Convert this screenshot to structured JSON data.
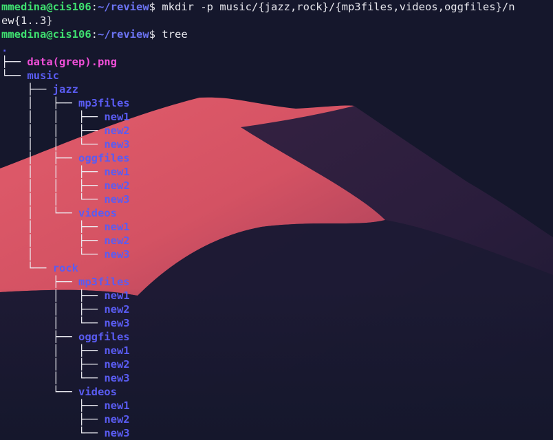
{
  "colors": {
    "background": "#15172c",
    "dune": "#d85868",
    "prompt_user": "#3fe070",
    "prompt_path": "#6c74f4",
    "directory": "#5a5cf2",
    "image_file": "#f04fd8"
  },
  "prompt": {
    "user_host": "mmedina@cis106",
    "cwd": "~/review",
    "symbol": "$"
  },
  "commands": {
    "first_line": "mkdir -p music/{jazz,rock}/{mp3files,videos,oggfiles}/n",
    "first_wrap": "ew{1..3}",
    "second": "tree"
  },
  "tree": {
    "root": ".",
    "entries": [
      {
        "prefix": "├── ",
        "name": "data(grep).png",
        "kind": "img"
      },
      {
        "prefix": "└── ",
        "name": "music",
        "kind": "dir"
      },
      {
        "prefix": "    ├── ",
        "name": "jazz",
        "kind": "dir"
      },
      {
        "prefix": "    │   ├── ",
        "name": "mp3files",
        "kind": "dir"
      },
      {
        "prefix": "    │   │   ├── ",
        "name": "new1",
        "kind": "dir"
      },
      {
        "prefix": "    │   │   ├── ",
        "name": "new2",
        "kind": "dir"
      },
      {
        "prefix": "    │   │   └── ",
        "name": "new3",
        "kind": "dir"
      },
      {
        "prefix": "    │   ├── ",
        "name": "oggfiles",
        "kind": "dir"
      },
      {
        "prefix": "    │   │   ├── ",
        "name": "new1",
        "kind": "dir"
      },
      {
        "prefix": "    │   │   ├── ",
        "name": "new2",
        "kind": "dir"
      },
      {
        "prefix": "    │   │   └── ",
        "name": "new3",
        "kind": "dir"
      },
      {
        "prefix": "    │   └── ",
        "name": "videos",
        "kind": "dir"
      },
      {
        "prefix": "    │       ├── ",
        "name": "new1",
        "kind": "dir"
      },
      {
        "prefix": "    │       ├── ",
        "name": "new2",
        "kind": "dir"
      },
      {
        "prefix": "    │       └── ",
        "name": "new3",
        "kind": "dir"
      },
      {
        "prefix": "    └── ",
        "name": "rock",
        "kind": "dir"
      },
      {
        "prefix": "        ├── ",
        "name": "mp3files",
        "kind": "dir"
      },
      {
        "prefix": "        │   ├── ",
        "name": "new1",
        "kind": "dir"
      },
      {
        "prefix": "        │   ├── ",
        "name": "new2",
        "kind": "dir"
      },
      {
        "prefix": "        │   └── ",
        "name": "new3",
        "kind": "dir"
      },
      {
        "prefix": "        ├── ",
        "name": "oggfiles",
        "kind": "dir"
      },
      {
        "prefix": "        │   ├── ",
        "name": "new1",
        "kind": "dir"
      },
      {
        "prefix": "        │   ├── ",
        "name": "new2",
        "kind": "dir"
      },
      {
        "prefix": "        │   └── ",
        "name": "new3",
        "kind": "dir"
      },
      {
        "prefix": "        └── ",
        "name": "videos",
        "kind": "dir"
      },
      {
        "prefix": "            ├── ",
        "name": "new1",
        "kind": "dir"
      },
      {
        "prefix": "            ├── ",
        "name": "new2",
        "kind": "dir"
      },
      {
        "prefix": "            └── ",
        "name": "new3",
        "kind": "dir"
      }
    ]
  }
}
